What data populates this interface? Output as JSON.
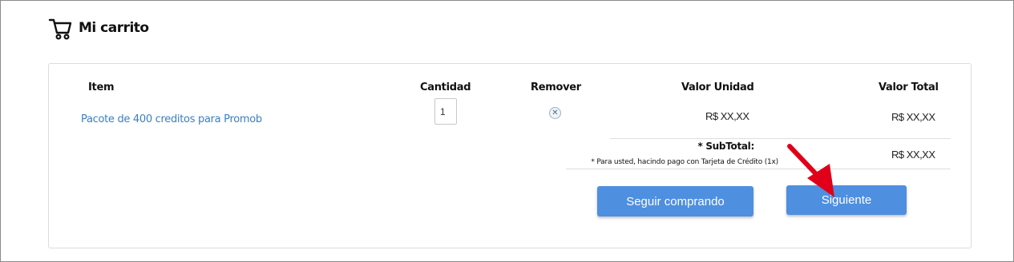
{
  "header": {
    "title": "Mi carrito",
    "icon": "shopping-cart-icon"
  },
  "table": {
    "columns": {
      "item": "Item",
      "cantidad": "Cantidad",
      "remover": "Remover",
      "valor_unidad": "Valor Unidad",
      "valor_total": "Valor Total"
    },
    "rows": [
      {
        "item": "Pacote de 400 creditos para Promob",
        "quantity": "1",
        "remove_icon": "close-circle-icon",
        "unit_price": "R$ XX,XX",
        "total_price": "R$ XX,XX"
      }
    ]
  },
  "subtotal": {
    "label": "* SubTotal:",
    "note": "* Para usted, hacindo pago con Tarjeta de Crédito (1x)",
    "value": "R$ XX,XX"
  },
  "actions": {
    "continue_shopping": "Seguir comprando",
    "next": "Siguiente"
  },
  "colors": {
    "button": "#4e8fe0",
    "link": "#3a7fc0",
    "annotation_arrow": "#e0001a"
  }
}
